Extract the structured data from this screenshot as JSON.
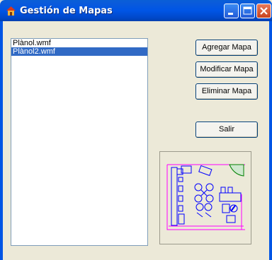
{
  "window": {
    "title": "Gestión de Mapas"
  },
  "title_buttons": {
    "minimize_icon": "minimize-icon",
    "maximize_icon": "maximize-icon",
    "close_icon": "close-icon"
  },
  "file_list": {
    "items": [
      {
        "label": "Plànol.wmf",
        "selected": false
      },
      {
        "label": "Plànol2.wmf",
        "selected": true
      }
    ]
  },
  "buttons": {
    "agregar": "Agregar Mapa",
    "modificar": "Modificar Mapa",
    "eliminar": "Eliminar Mapa",
    "salir": "Salir"
  },
  "preview": {
    "icon": "floor-plan-thumbnail"
  },
  "colors": {
    "selection": "#316AC5",
    "titlebar": "#0055E5",
    "plan_lines": "#0000FF",
    "plan_border": "#FF00FF",
    "plan_accent": "#008000"
  }
}
